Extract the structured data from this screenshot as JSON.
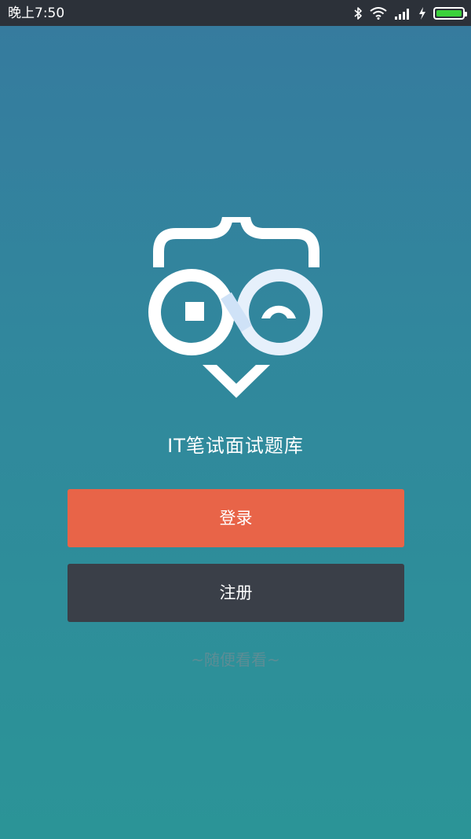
{
  "status_bar": {
    "time": "晚上7:50",
    "icons": [
      "bluetooth-icon",
      "wifi-icon",
      "signal-icon",
      "charging-icon",
      "battery-icon"
    ],
    "battery_color": "#3bd23b"
  },
  "app": {
    "logo": "owl-logo-icon",
    "title": "IT笔试面试题库"
  },
  "buttons": {
    "login_label": "登录",
    "register_label": "注册"
  },
  "browse_label": "~随便看看~",
  "colors": {
    "login_button": "#e86448",
    "register_button": "#3a3f48",
    "background_top": "#367a9e",
    "background_bottom": "#2b9497"
  }
}
